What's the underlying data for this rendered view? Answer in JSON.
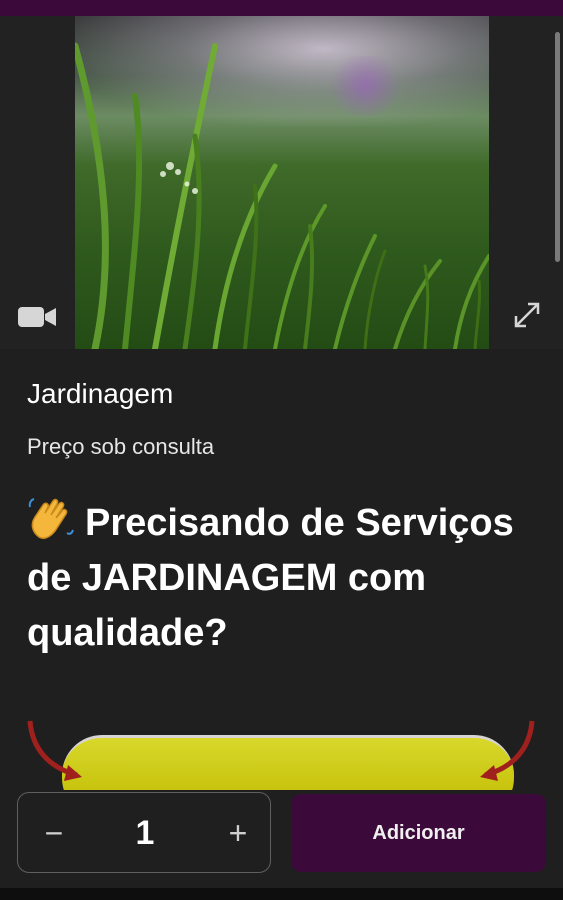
{
  "product": {
    "title": "Jardinagem",
    "price_text": "Preço sob consulta",
    "headline": "Precisando de Serviços de JARDINAGEM com qualidade?",
    "headline_emoji": "waving-hand"
  },
  "media": {
    "video_icon": "video-camera-icon",
    "expand_icon": "expand-icon"
  },
  "cart": {
    "quantity": "1",
    "decrement_label": "−",
    "increment_label": "+",
    "add_label": "Adicionar"
  },
  "colors": {
    "brand": "#3b0a3a",
    "background": "#1f1f1f",
    "promo": "#c9c510"
  }
}
